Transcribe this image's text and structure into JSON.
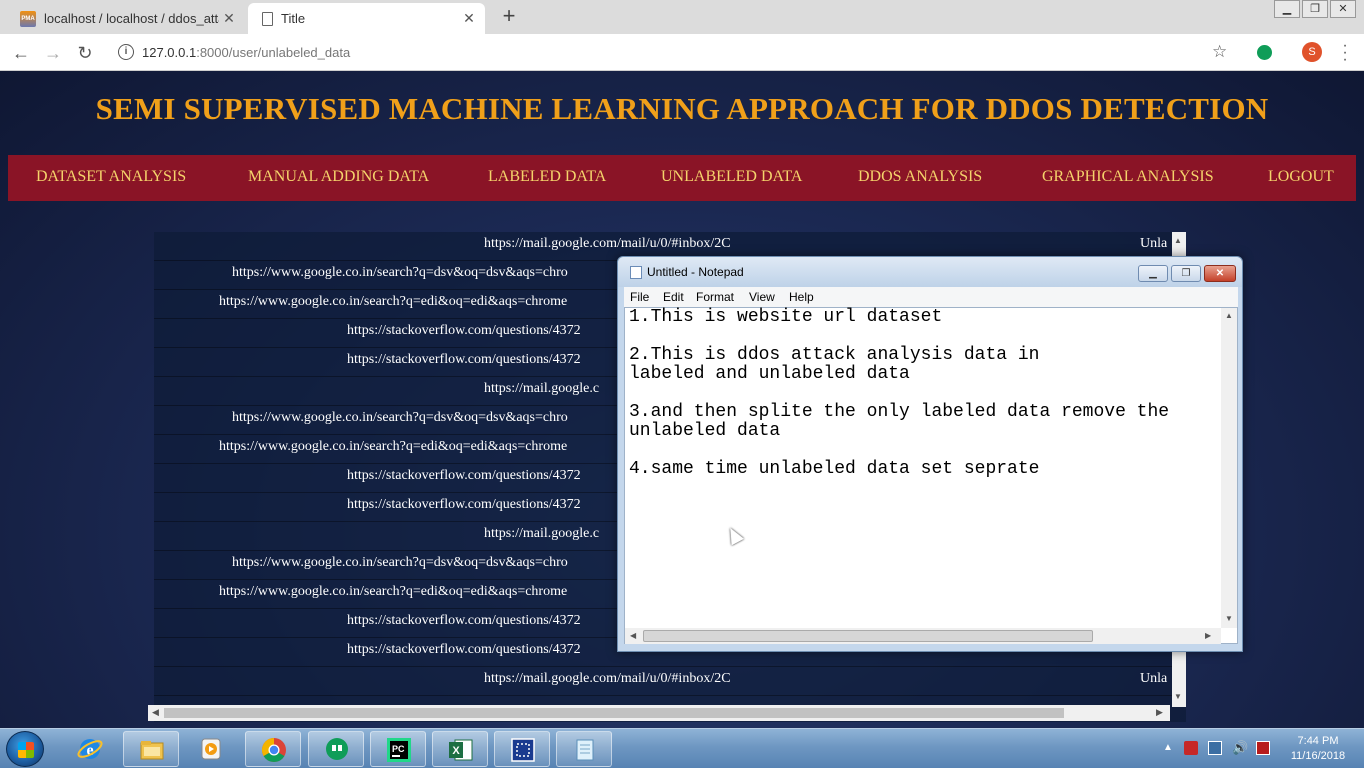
{
  "browser": {
    "tabs": [
      {
        "title": "localhost / localhost / ddos_attac",
        "favicon": "phpmyadmin-icon"
      },
      {
        "title": "Title",
        "favicon": "document-icon"
      }
    ],
    "url_host": "127.0.0.1",
    "url_port_path": ":8000/user/unlabeled_data",
    "avatar_letter": "S"
  },
  "page": {
    "title": "SEMI SUPERVISED MACHINE LEARNING APPROACH FOR DDOS DETECTION",
    "nav": [
      "DATASET ANALYSIS",
      "MANUAL ADDING DATA",
      "LABELED DATA",
      "UNLABELED DATA",
      "DDOS ANALYSIS",
      "GRAPHICAL ANALYSIS",
      "LOGOUT"
    ],
    "rows": [
      {
        "url": "https://mail.google.com/mail/u/0/#inbox/2C",
        "status": "Unla"
      },
      {
        "url": "https://www.google.co.in/search?q=dsv&oq=dsv&aqs=chro",
        "status": ""
      },
      {
        "url": "https://www.google.co.in/search?q=edi&oq=edi&aqs=chrome",
        "status": ""
      },
      {
        "url": "https://stackoverflow.com/questions/4372",
        "status": ""
      },
      {
        "url": "https://stackoverflow.com/questions/4372",
        "status": ""
      },
      {
        "url": "https://mail.google.c",
        "status": ""
      },
      {
        "url": "https://www.google.co.in/search?q=dsv&oq=dsv&aqs=chro",
        "status": ""
      },
      {
        "url": "https://www.google.co.in/search?q=edi&oq=edi&aqs=chrome",
        "status": ""
      },
      {
        "url": "https://stackoverflow.com/questions/4372",
        "status": ""
      },
      {
        "url": "https://stackoverflow.com/questions/4372",
        "status": ""
      },
      {
        "url": "https://mail.google.c",
        "status": ""
      },
      {
        "url": "https://www.google.co.in/search?q=dsv&oq=dsv&aqs=chro",
        "status": ""
      },
      {
        "url": "https://www.google.co.in/search?q=edi&oq=edi&aqs=chrome",
        "status": ""
      },
      {
        "url": "https://stackoverflow.com/questions/4372",
        "status": ""
      },
      {
        "url": "https://stackoverflow.com/questions/4372",
        "status": ""
      },
      {
        "url": "https://mail.google.com/mail/u/0/#inbox/2C",
        "status": "Unla"
      }
    ]
  },
  "notepad": {
    "title": "Untitled - Notepad",
    "menu": [
      "File",
      "Edit",
      "Format",
      "View",
      "Help"
    ],
    "lines": [
      "1.This is website url dataset",
      "",
      "2.This is ddos attack analysis data in",
      "labeled and unlabeled data",
      "",
      "3.and then splite the only labeled data remove the",
      "unlabeled data",
      "",
      "4.same time unlabeled data set seprate"
    ]
  },
  "taskbar": {
    "apps": [
      "internet-explorer-icon",
      "file-explorer-icon",
      "media-player-icon",
      "chrome-icon",
      "hangouts-icon",
      "pycharm-icon",
      "excel-icon",
      "screen-recorder-icon",
      "notepad-icon"
    ],
    "time": "7:44 PM",
    "date": "11/16/2018"
  },
  "colors": {
    "title_text": "#f0a01a",
    "navbar_bg": "#8a1426",
    "nav_text": "#f5d36b"
  }
}
